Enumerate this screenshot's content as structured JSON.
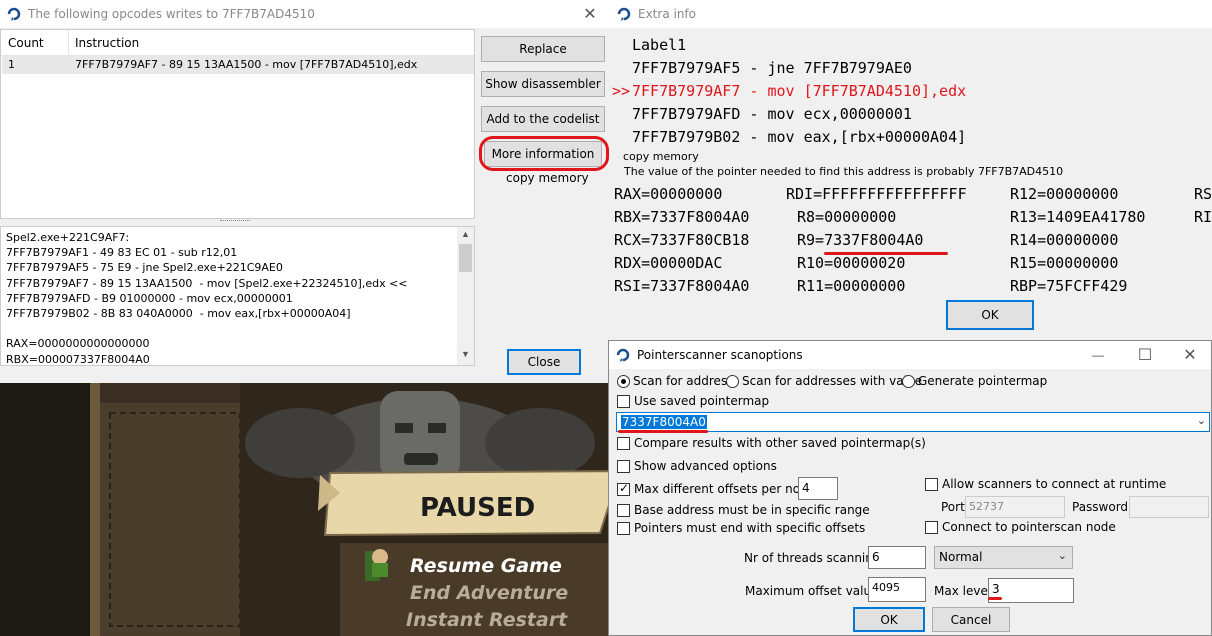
{
  "colors": {
    "highlight_red": "#e0161b",
    "selection_blue": "#0078d7",
    "game_bg": "#3d3326"
  },
  "opcode_window": {
    "title": "The following opcodes writes to 7FF7B7AD4510",
    "close_glyph": "✕",
    "columns": [
      "Count",
      "Instruction"
    ],
    "rows": [
      {
        "count": "1",
        "instruction": "7FF7B7979AF7 - 89 15 13AA1500  - mov [7FF7B7AD4510],edx"
      }
    ],
    "buttons": {
      "replace": "Replace",
      "show_disassembler": "Show disassembler",
      "add_to_codelist": "Add to the codelist",
      "more_information": "More information",
      "close": "Close"
    },
    "copy_memory": "copy memory",
    "details_lines": [
      "Spel2.exe+221C9AF7:",
      "7FF7B7979AF1 - 49 83 EC 01 - sub r12,01",
      "7FF7B7979AF5 - 75 E9 - jne Spel2.exe+221C9AE0",
      "7FF7B7979AF7 - 89 15 13AA1500  - mov [Spel2.exe+22324510],edx <<",
      "7FF7B7979AFD - B9 01000000 - mov ecx,00000001",
      "7FF7B7979B02 - 8B 83 040A0000  - mov eax,[rbx+00000A04]",
      "",
      "RAX=0000000000000000",
      "RBX=000007337F8004A0"
    ]
  },
  "extra_info": {
    "title": "Extra info",
    "code_lines": [
      {
        "prefix": "",
        "text": "Label1",
        "highlight": false
      },
      {
        "prefix": "",
        "text": "7FF7B7979AF5 - jne 7FF7B7979AE0",
        "highlight": false
      },
      {
        "prefix": ">>",
        "text": "7FF7B7979AF7 - mov [7FF7B7AD4510],edx",
        "highlight": true
      },
      {
        "prefix": "",
        "text": "7FF7B7979AFD - mov ecx,00000001",
        "highlight": false
      },
      {
        "prefix": "",
        "text": "7FF7B7979B02 - mov eax,[rbx+00000A04]",
        "highlight": false
      }
    ],
    "copy_memory": "copy memory",
    "pointer_note": "The value of the pointer needed to find this address is probably 7FF7B7AD4510",
    "registers": [
      [
        "RAX=00000000",
        "RDI=FFFFFFFFFFFFFFFF",
        "R12=00000000",
        "RSP"
      ],
      [
        "RBX=7337F8004A0",
        "R8=00000000",
        "R13=1409EA41780",
        "RIP"
      ],
      [
        "RCX=7337F80CB18",
        "R9=7337F8004A0",
        "R14=00000000",
        ""
      ],
      [
        "RDX=00000DAC",
        "R10=00000020",
        "R15=00000000",
        ""
      ],
      [
        "RSI=7337F8004A0",
        "R11=00000000",
        "",
        "RBP=75FCFF429"
      ]
    ],
    "ok_label": "OK"
  },
  "game": {
    "paused_text": "PAUSED",
    "menu": [
      "Resume Game",
      "End Adventure",
      "Instant Restart"
    ]
  },
  "scanoptions": {
    "title": "Pointerscanner scanoptions",
    "minimize_glyph": "—",
    "maximize_glyph": "☐",
    "close_glyph": "✕",
    "radio_scan_for_address": "Scan for address",
    "radio_scan_for_value": "Scan for addresses with value",
    "radio_generate_map": "Generate pointermap",
    "use_saved_pointermap": "Use saved pointermap",
    "address_value": "7337F8004A0",
    "compare_results": "Compare results with other saved pointermap(s)",
    "show_advanced": "Show advanced options",
    "max_offsets_label": "Max different offsets per node:",
    "max_offsets_value": "4",
    "base_address_range": "Base address must be in specific range",
    "pointers_end_offsets": "Pointers must end with specific offsets",
    "allow_scanners": "Allow scanners to connect at runtime",
    "port_label": "Port:",
    "port_value": "52737",
    "password_label": "Password",
    "connect_node": "Connect to pointerscan node",
    "threads_label": "Nr of threads scanning:",
    "threads_value": "6",
    "priority_value": "Normal",
    "max_offset_label": "Maximum offset value:",
    "max_offset_value": "4095",
    "max_level_label": "Max level",
    "max_level_value": "3",
    "ok_label": "OK",
    "cancel_label": "Cancel"
  }
}
